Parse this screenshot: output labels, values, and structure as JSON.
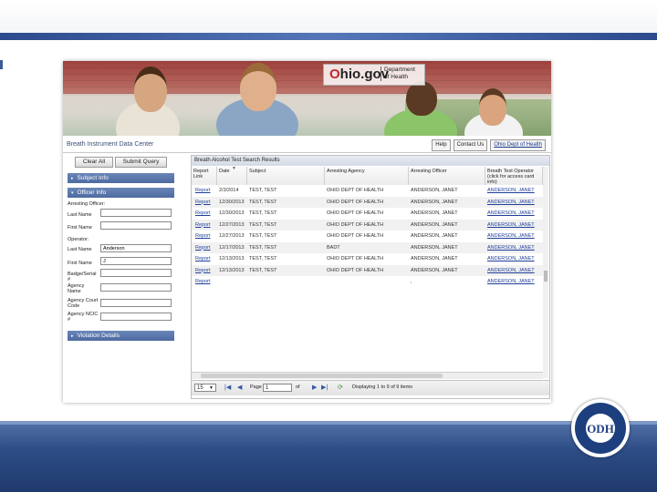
{
  "banner": {
    "ohio_logo": "Ohio.gov",
    "dept_line1": "Department",
    "dept_line2": "of Health"
  },
  "header": {
    "app_title": "Breath Instrument Data Center",
    "links": [
      "Help",
      "Contact Us",
      "Ohio Dept of Health"
    ]
  },
  "toolbar": {
    "clear_label": "Clear All",
    "submit_label": "Submit Query"
  },
  "left_panel": {
    "subject_info": "Subject Info",
    "officer_info": "Officer Info",
    "violation_details": "Violation Details",
    "arresting_officer": "Arresting Officer:",
    "operator": "Operator:",
    "last_name": "Last Name",
    "first_name": "First Name",
    "officer_last_value": "",
    "officer_first_value": "",
    "operator_last_value": "Anderson",
    "operator_first_value": "J",
    "badge_label": "Badge/Serial #",
    "agency_name_label": "Agency Name",
    "agency_court_label": "Agency Court Code",
    "agency_ncic_label": "Agency NCIC #"
  },
  "grid": {
    "title": "Breath Alcohol Test Search Results",
    "columns": [
      "Report Link",
      "Date",
      "Subject",
      "Arresting Agency",
      "Arresting Officer",
      "Breath Test Operator (click for access card info)"
    ],
    "rows": [
      [
        "Report",
        "2/3/2014",
        "TEST, TEST",
        "OHIO DEPT OF HEALTH",
        "ANDERSON, JANET",
        "ANDERSON, JANET"
      ],
      [
        "Report",
        "12/30/2013",
        "TEST, TEST",
        "OHIO DEPT OF HEALTH",
        "ANDERSON, JANET",
        "ANDERSON, JANET"
      ],
      [
        "Report",
        "12/30/2013",
        "TEST, TEST",
        "OHIO DEPT OF HEALTH",
        "ANDERSON, JANET",
        "ANDERSON, JANET"
      ],
      [
        "Report",
        "12/27/2013",
        "TEST, TEST",
        "OHIO DEPT OF HEALTH",
        "ANDERSON, JANET",
        "ANDERSON, JANET"
      ],
      [
        "Report",
        "12/27/2013",
        "TEST, TEST",
        "OHIO DEPT OF HEALTH",
        "ANDERSON, JANET",
        "ANDERSON, JANET"
      ],
      [
        "Report",
        "12/17/2013",
        "TEST, TEST",
        "BADT",
        "ANDERSON, JANET",
        "ANDERSON, JANET"
      ],
      [
        "Report",
        "12/13/2013",
        "TEST, TEST",
        "OHIO DEPT OF HEALTH",
        "ANDERSON, JANET",
        "ANDERSON, JANET"
      ],
      [
        "Report",
        "12/13/2013",
        "TEST, TEST",
        "OHIO DEPT OF HEALTH",
        "ANDERSON, JANET",
        "ANDERSON, JANET"
      ],
      [
        "Report",
        "",
        "",
        "",
        ",",
        "ANDERSON, JANET"
      ]
    ]
  },
  "pager": {
    "page_size": "15",
    "page_label": "Page",
    "page_value": "1",
    "of_label": "of",
    "status": "Displaying 1 to 9 of 9 items"
  },
  "seal": {
    "text": "ODH"
  },
  "colors": {
    "band": "#2c4a8c",
    "section_header": "#4d6aa0",
    "link": "#1f3f9a"
  },
  "icons": [
    "first-page-icon",
    "prev-page-icon",
    "next-page-icon",
    "last-page-icon",
    "refresh-icon",
    "sort-arrow-icon"
  ]
}
